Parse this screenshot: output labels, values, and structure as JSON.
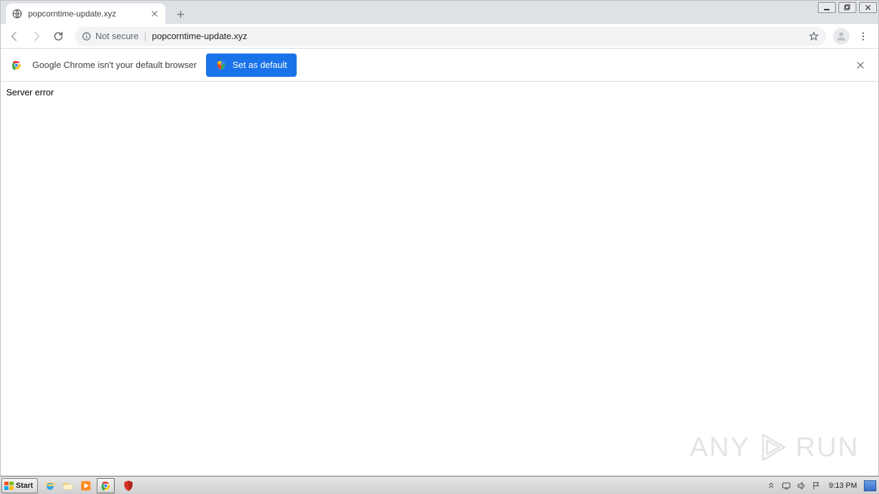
{
  "tab": {
    "title": "popcorntime-update.xyz"
  },
  "address": {
    "security_label": "Not secure",
    "url": "popcorntime-update.xyz"
  },
  "infobar": {
    "message": "Google Chrome isn't your default browser",
    "button_label": "Set as default"
  },
  "page": {
    "body_text": "Server error"
  },
  "watermark": {
    "left": "ANY",
    "right": "RUN"
  },
  "taskbar": {
    "start_label": "Start",
    "clock": "9:13 PM"
  }
}
